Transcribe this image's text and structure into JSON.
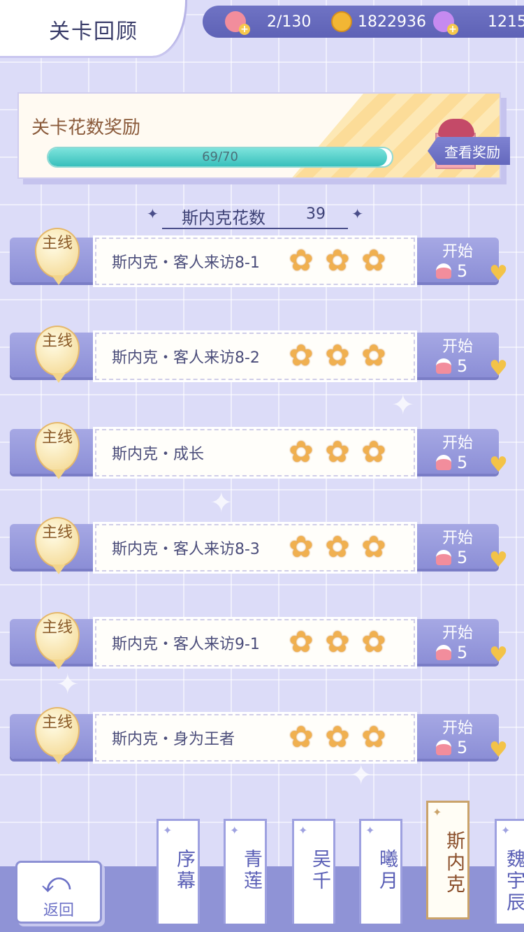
{
  "header": {
    "title": "关卡回顾"
  },
  "resources": [
    {
      "icon": "cake-icon",
      "value": "2/130"
    },
    {
      "icon": "gold-coin-icon",
      "value": "1822936"
    },
    {
      "icon": "crystal-swan-icon",
      "value": "1215"
    }
  ],
  "reward": {
    "title": "关卡花数奖励",
    "progress_text": "69/70",
    "progress_fraction": 0.986,
    "button": "查看奖励"
  },
  "count": {
    "label": "斯内克花数",
    "value": "39"
  },
  "levels": [
    {
      "tag": "主线",
      "name": "斯内克・客人来访8-1",
      "stars": "✿✿✿",
      "start": "开始",
      "cost": "5"
    },
    {
      "tag": "主线",
      "name": "斯内克・客人来访8-2",
      "stars": "✿✿✿",
      "start": "开始",
      "cost": "5"
    },
    {
      "tag": "主线",
      "name": "斯内克・成长",
      "stars": "✿✿✿",
      "start": "开始",
      "cost": "5"
    },
    {
      "tag": "主线",
      "name": "斯内克・客人来访8-3",
      "stars": "✿✿✿",
      "start": "开始",
      "cost": "5"
    },
    {
      "tag": "主线",
      "name": "斯内克・客人来访9-1",
      "stars": "✿✿✿",
      "start": "开始",
      "cost": "5"
    },
    {
      "tag": "主线",
      "name": "斯内克・身为王者",
      "stars": "✿✿✿",
      "start": "开始",
      "cost": "5"
    }
  ],
  "back": {
    "label": "返回"
  },
  "chapters": [
    {
      "label": "序幕",
      "active": false
    },
    {
      "label": "青莲",
      "active": false
    },
    {
      "label": "吴千",
      "active": false
    },
    {
      "label": "曦月",
      "active": false
    },
    {
      "label": "斯内克",
      "active": true
    },
    {
      "label": "魏宇辰",
      "active": false
    }
  ],
  "colors": {
    "accent": "#6f73c4",
    "progress": "#38c0bc",
    "flower": "#f0b050"
  }
}
